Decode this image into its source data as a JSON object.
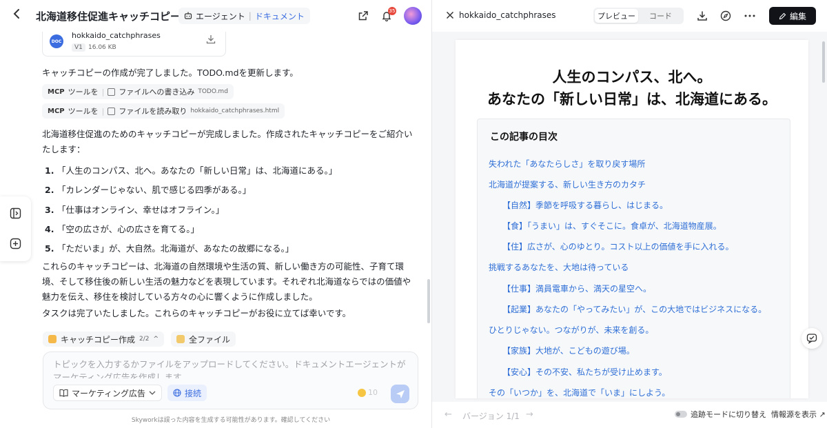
{
  "left": {
    "title": "北海道移住促進キャッチコピー",
    "agent_label": "エージェント",
    "agent_separator": "|",
    "agent_doc": "ドキュメント",
    "bell_count": "35",
    "file": {
      "badge": "DOC",
      "name": "hokkaido_catchphrases",
      "version": "V1",
      "size": "16.06 KB"
    },
    "msg1": "キャッチコピーの作成が完了しました。TODO.mdを更新します。",
    "tool1": {
      "mcp": "MCP",
      "label": "ツールを",
      "sep": "|",
      "action": "ファイルへの書き込み",
      "file": "TODO.md"
    },
    "tool2": {
      "mcp": "MCP",
      "label": "ツールを",
      "sep": "|",
      "action": "ファイルを読み取り",
      "file": "hokkaido_catchphrases.html"
    },
    "msg2_line1": "北海道移住促進のためのキャッチコピーが完成しました。作成されたキャッチコピーをご紹介い",
    "msg2_line2": "たします：",
    "list": [
      {
        "num": "1.",
        "text": "「人生のコンパス、北へ。あなたの「新しい日常」は、北海道にある。」"
      },
      {
        "num": "2.",
        "text": "「カレンダーじゃない、肌で感じる四季がある。」"
      },
      {
        "num": "3.",
        "text": "「仕事はオンライン、幸せはオフライン。」"
      },
      {
        "num": "4.",
        "text": "「空の広さが、心の広さを育てる。」"
      },
      {
        "num": "5.",
        "text": "「ただいま」が、大自然。北海道が、あなたの故郷になる。」"
      }
    ],
    "msg3_line1": "これらのキャッチコピーは、北海道の自然環境や生活の質、新しい働き方の可能性、子育て環",
    "msg3_line2": "境、そして移住後の新しい生活の魅力などを表現しています。それぞれ北海道ならではの価値や",
    "msg3_line3": "魅力を伝え、移住を検討している方々の心に響くように作成しました。",
    "msg4": "タスクは完了いたしました。これらのキャッチコピーがお役に立てば幸いです。",
    "chips": {
      "task_label": "キャッチコピー作成",
      "task_count": "2/2",
      "task_chevron": "^",
      "files_label": "全ファイル"
    },
    "composer": {
      "placeholder": "トピックを入力するかファイルをアップロードしてください。ドキュメントエージェントがマーケティング広告を作成します。",
      "mode_label": "マーケティング広告",
      "connect_label": "接続",
      "credits": "10"
    },
    "disclaimer": "Skyworkは誤った内容を生成する可能性があります。確認してください"
  },
  "right": {
    "filename": "hokkaido_catchphrases",
    "tab_preview": "プレビュー",
    "tab_code": "コード",
    "edit_label": "編集",
    "doc": {
      "heading1": "人生のコンパス、北へ。",
      "heading2": "あなたの「新しい日常」は、北海道にある。",
      "toc_title": "この記事の目次",
      "toc": [
        "失われた「あなたらしさ」を取り戻す場所",
        "北海道が提案する、新しい生き方のカタチ",
        "【自然】季節を呼吸する暮らし、はじまる。",
        "【食】「うまい」は、すぐそこに。食卓が、北海道物産展。",
        "【住】広さが、心のゆとり。コスト以上の価値を手に入れる。",
        "挑戦するあなたを、大地は待っている",
        "【仕事】満員電車から、満天の星空へ。",
        "【起業】あなたの「やってみたい」が、この大地ではビジネスになる。",
        "ひとりじゃない。つながりが、未来を創る。",
        "【家族】大地が、こどもの遊び場。",
        "【安心】その不安、私たちが受け止めます。",
        "その「いつか」を、北海道で「いま」にしよう。"
      ]
    },
    "footer": {
      "version_label": "バージョン 1/1",
      "prev": "←",
      "next": "→",
      "track_label": "追跡モードに切り替え",
      "source_label": "情報源を表示 ↗"
    }
  },
  "icons": {
    "back": "chevron-left-icon",
    "share": "share-icon",
    "bell": "bell-icon",
    "download": "download-icon",
    "compass": "compass-icon",
    "more": "more-icon",
    "close": "close-icon",
    "edit": "pencil-icon",
    "send": "send-icon",
    "globe": "globe-icon",
    "book": "book-icon"
  },
  "colors": {
    "accent": "#3b6de0",
    "link": "#2f6fd6",
    "edit_button": "#111318",
    "badge": "#e8483c"
  }
}
